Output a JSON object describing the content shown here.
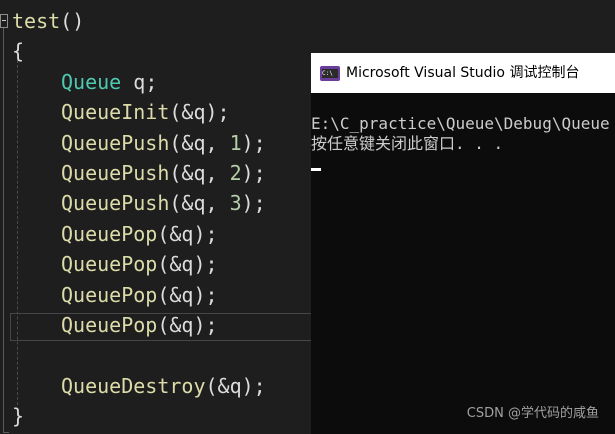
{
  "editor": {
    "function_name": "test",
    "function_parens": "()",
    "open_brace": "{",
    "close_brace": "}",
    "declaration": {
      "type": "Queue",
      "variable": "q",
      "end": ";"
    },
    "calls": [
      {
        "func": "QueueInit",
        "open": "(&q",
        "close": ");"
      },
      {
        "func": "QueuePush",
        "open": "(&q, ",
        "number": "1",
        "close": ");"
      },
      {
        "func": "QueuePush",
        "open": "(&q, ",
        "number": "2",
        "close": ");"
      },
      {
        "func": "QueuePush",
        "open": "(&q, ",
        "number": "3",
        "close": ");"
      },
      {
        "func": "QueuePop",
        "open": "(&q",
        "close": ");"
      },
      {
        "func": "QueuePop",
        "open": "(&q",
        "close": ");"
      },
      {
        "func": "QueuePop",
        "open": "(&q",
        "close": ");"
      },
      {
        "func": "QueuePop",
        "open": "(&q",
        "close": ");"
      },
      {
        "func": "QueueDestroy",
        "open": "(&q",
        "close": ");"
      }
    ]
  },
  "console": {
    "icon_name": "console-app-icon",
    "icon_text": "C:\\",
    "title": "Microsoft Visual Studio 调试控制台",
    "lines": [
      "E:\\C_practice\\Queue\\Debug\\Queue",
      "按任意键关闭此窗口. . ."
    ]
  },
  "watermark": "CSDN @学代码的咸鱼",
  "colors": {
    "background": "#1e1e1e",
    "type": "#4ec9b0",
    "function": "#dcdcaa",
    "number": "#b5cea8",
    "console_bg": "#0c0c0c"
  }
}
